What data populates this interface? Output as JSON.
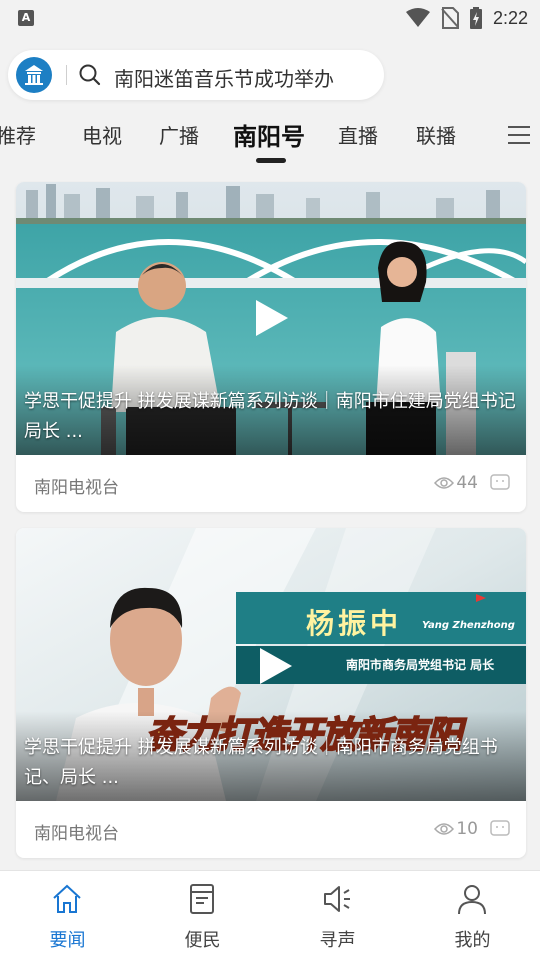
{
  "status_bar": {
    "left_icon": "A",
    "time": "2:22",
    "icons": [
      "wifi-icon",
      "no-sim-icon",
      "battery-icon"
    ]
  },
  "search": {
    "logo_icon": "nanyang-logo-icon",
    "text": "南阳迷笛音乐节成功举办"
  },
  "tabs": [
    {
      "label": "推荐",
      "active": false
    },
    {
      "label": "电视",
      "active": false
    },
    {
      "label": "广播",
      "active": false
    },
    {
      "label": "南阳号",
      "active": true
    },
    {
      "label": "直播",
      "active": false
    },
    {
      "label": "联播",
      "active": false
    }
  ],
  "articles": [
    {
      "title": "学思干促提升 拼发展谋新篇系列访谈｜南阳市住建局党组书记 局长 ...",
      "source": "南阳电视台",
      "views": "44"
    },
    {
      "title": "学思干促提升 拼发展谋新篇系列访谈｜南阳市商务局党组书记、局长 ...",
      "source": "南阳电视台",
      "views": "10",
      "overlay": {
        "name": "杨振中",
        "pinyin": "Yang Zhenzhong",
        "position": "南阳市商务局党组书记 局长",
        "slogan": "奋力打造开放新南阳"
      }
    }
  ],
  "bottom_nav": [
    {
      "label": "要闻",
      "icon": "home-icon",
      "active": true
    },
    {
      "label": "便民",
      "icon": "document-icon",
      "active": false
    },
    {
      "label": "寻声",
      "icon": "speaker-icon",
      "active": false
    },
    {
      "label": "我的",
      "icon": "person-icon",
      "active": false
    }
  ],
  "colors": {
    "accent": "#1976d2",
    "background": "#f2f2f2"
  }
}
